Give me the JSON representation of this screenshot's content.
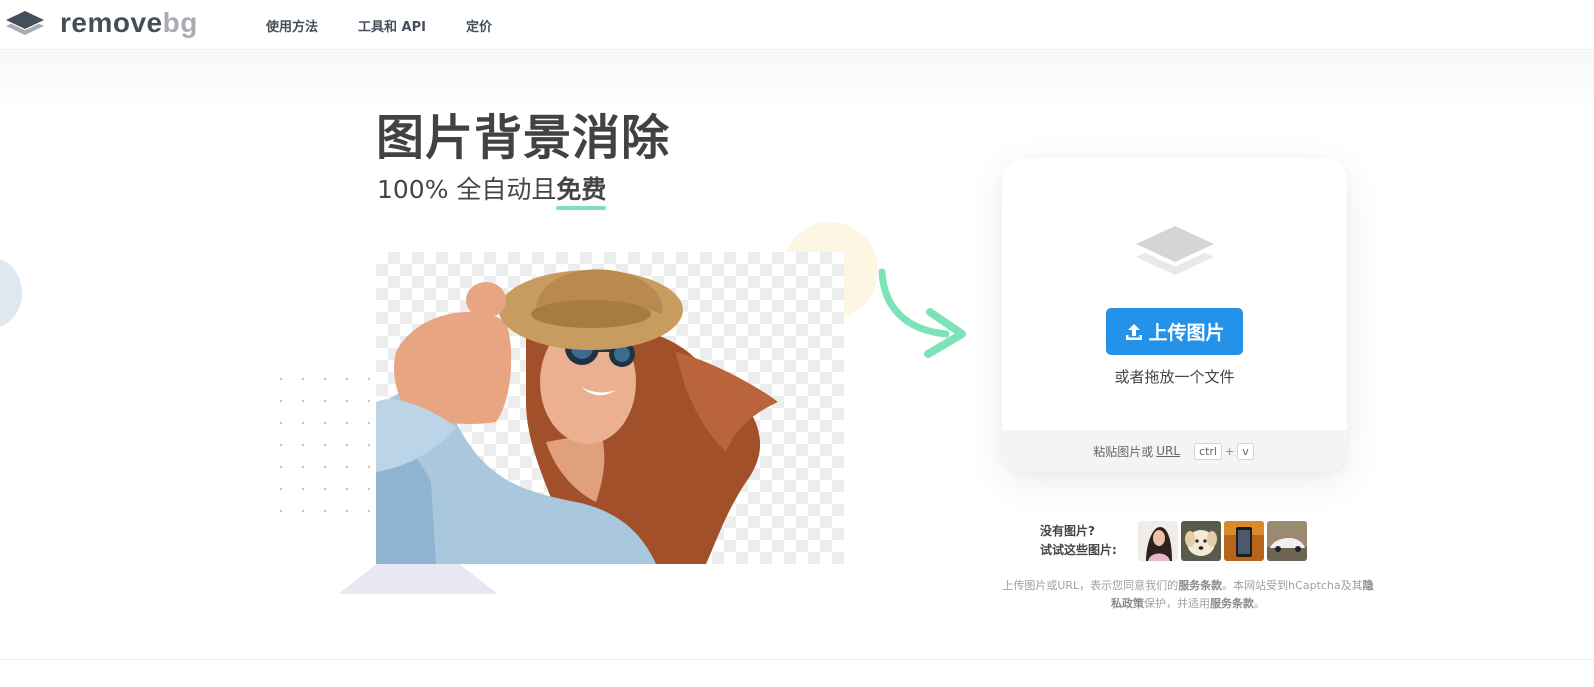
{
  "header": {
    "brand_main": "remove",
    "brand_suffix": "bg",
    "nav": [
      "使用方法",
      "工具和 API",
      "定价"
    ]
  },
  "hero": {
    "title": "图片背景消除",
    "subtitle_prefix": "100% 全自动且",
    "subtitle_emphasis": "免费"
  },
  "upload": {
    "button_label": "上传图片",
    "drop_text": "或者拖放一个文件",
    "paste_text": "粘贴图片或",
    "paste_url": "URL",
    "key_ctrl": "ctrl",
    "key_plus": "+",
    "key_v": "v"
  },
  "samples": {
    "line1": "没有图片?",
    "line2": "试试这些图片:",
    "thumbnails": [
      "woman-thumbnail",
      "dog-thumbnail",
      "phone-thumbnail",
      "car-thumbnail"
    ]
  },
  "legal": {
    "part1": "上传图片或URL，表示您同意我们的",
    "terms1": "服务条款",
    "part2": "。本网站受到hCaptcha及其",
    "privacy": "隐私政策",
    "part3": "保护，并适用",
    "terms2": "服务条款",
    "part4": "。"
  },
  "colors": {
    "accent_blue": "#2592e9",
    "accent_green": "#7ee2b8",
    "text_dark": "#454545"
  }
}
